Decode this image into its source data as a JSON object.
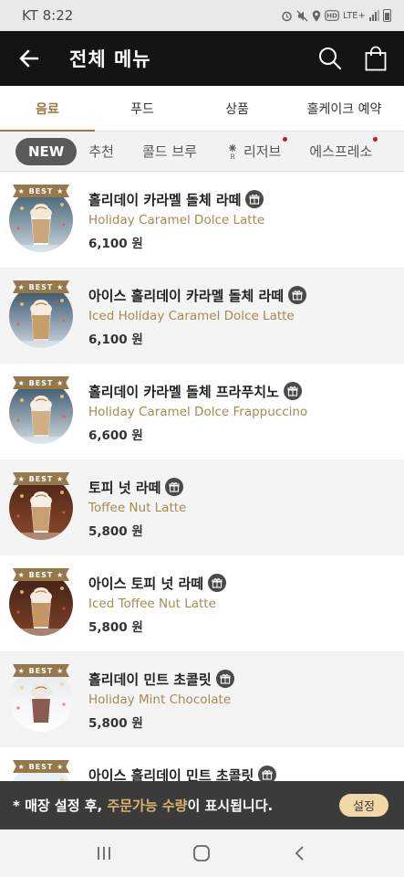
{
  "status_bar": {
    "carrier_time": "KT 8:22",
    "lte_label": "LTE+"
  },
  "header": {
    "title": "전체 메뉴",
    "back_icon": "arrow-left-icon",
    "search_icon": "search-icon",
    "bag_icon": "shopping-bag-icon"
  },
  "tabs": [
    {
      "label": "음료",
      "active": true
    },
    {
      "label": "푸드",
      "active": false
    },
    {
      "label": "상품",
      "active": false
    },
    {
      "label": "홀케이크 예약",
      "active": false
    }
  ],
  "subfilter": {
    "new_label": "NEW",
    "items": [
      {
        "label": "추천"
      },
      {
        "label": "콜드 브루"
      },
      {
        "label": "리저브"
      },
      {
        "label": "에스프레소"
      }
    ],
    "reserve_mark": "R"
  },
  "menu": {
    "badge_label": "★ BEST ★",
    "items": [
      {
        "name": "홀리데이 카라멜 돌체 라떼",
        "eng": "Holiday Caramel Dolce Latte",
        "price": "6,100 원",
        "drink": "hot-latte"
      },
      {
        "name": "아이스 홀리데이 카라멜 돌체 라떼",
        "eng": "Iced Holiday Caramel Dolce Latte",
        "price": "6,100 원",
        "drink": "iced-latte"
      },
      {
        "name": "홀리데이 카라멜 돌체 프라푸치노",
        "eng": "Holiday Caramel Dolce Frappuccino",
        "price": "6,600 원",
        "drink": "frappuccino"
      },
      {
        "name": "토피 넛 라떼",
        "eng": "Toffee Nut Latte",
        "price": "5,800 원",
        "drink": "hot-latte-dark"
      },
      {
        "name": "아이스 토피 넛 라떼",
        "eng": "Iced Toffee Nut Latte",
        "price": "5,800 원",
        "drink": "iced-latte-dark"
      },
      {
        "name": "홀리데이 민트 초콜릿",
        "eng": "Holiday Mint Chocolate",
        "price": "5,800 원",
        "drink": "mint-chocolate"
      },
      {
        "name": "아이스 홀리데이 민트 초콜릿",
        "eng": "",
        "price": "",
        "drink": "iced-mint"
      }
    ]
  },
  "notice": {
    "prefix": "* 매장 설정 후, ",
    "highlight": "주문가능 수량",
    "suffix": "이 표시됩니다.",
    "button_label": "설정"
  },
  "colors": {
    "accent": "#9b7b47",
    "header_bg": "#141414",
    "notice_bg": "#3b3b3b",
    "notice_highlight": "#d9b46b",
    "notice_button": "#f1d8a6"
  }
}
